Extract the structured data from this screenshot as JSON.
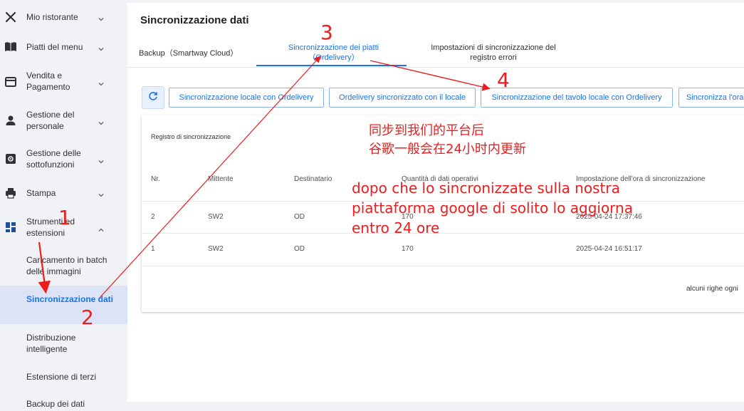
{
  "sidebar": {
    "items": [
      {
        "label": "Mio ristorante",
        "icon": "fork-knife-icon"
      },
      {
        "label": "Piatti del menu",
        "icon": "book-icon"
      },
      {
        "label": "Vendita e Pagamento",
        "icon": "payment-card-icon"
      },
      {
        "label": "Gestione del personale",
        "icon": "person-icon"
      },
      {
        "label": "Gestione delle sottofunzioni",
        "icon": "gear-box-icon"
      },
      {
        "label": "Stampa",
        "icon": "printer-icon"
      },
      {
        "label": "Strumenti ed estensioni",
        "icon": "dashboard-icon"
      }
    ],
    "sub_items": [
      {
        "label": "Caricamento in batch delle immagini"
      },
      {
        "label": "Sincronizzazione dati"
      },
      {
        "label": "Distribuzione intelligente"
      },
      {
        "label": "Estensione di terzi"
      },
      {
        "label": "Backup dei dati"
      }
    ]
  },
  "main": {
    "title": "Sincronizzazione dati",
    "tabs": [
      {
        "label": "Backup（Smartway Cloud）"
      },
      {
        "label": "Sincronizzazione dei piatti（Ordelivery）"
      },
      {
        "label": "Impostazioni di sincronizzazione del registro errori"
      }
    ],
    "buttons": [
      {
        "label": "Sincronizzazione locale con Ordelivery"
      },
      {
        "label": "Ordelivery sincronizzato con il locale"
      },
      {
        "label": "Sincronizzazione del tavolo locale con Ordelivery"
      },
      {
        "label": "Sincronizza l'ora"
      }
    ],
    "log": {
      "title": "Registro di sincronizzazione",
      "columns": [
        "Nr.",
        "Mittente",
        "Destinatario",
        "Quantità di dati operativi",
        "Impostazione dell'ora di sincronizzazione"
      ],
      "rows": [
        [
          "2",
          "SW2",
          "OD",
          "170",
          "2025-04-24 17:37:46"
        ],
        [
          "1",
          "SW2",
          "OD",
          "170",
          "2025-04-24 16:51:17"
        ]
      ],
      "footer": "alcuni righe ogni"
    }
  },
  "annotations": {
    "numbers": [
      "1",
      "2",
      "3",
      "4"
    ],
    "chinese_lines": [
      "同步到我们的平台后",
      "谷歌一般会在24小时内更新"
    ],
    "italian_text": "dopo che lo sincronizzate sulla nostra piattaforma google di solito lo aggiorna entro 24 ore",
    "color": "#ee1c1c"
  },
  "colors": {
    "accent": "#1a73e8",
    "sidebar_bg": "#f0f2f5",
    "active_item_bg": "#dde3f6"
  }
}
